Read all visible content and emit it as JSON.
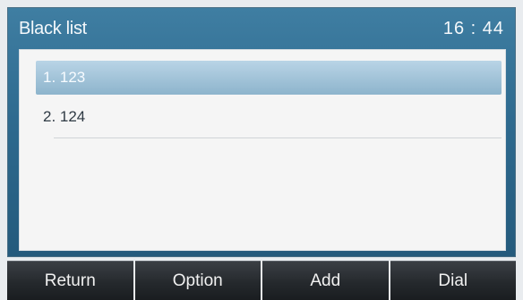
{
  "header": {
    "title": "Black list",
    "time": "16 : 44"
  },
  "list": {
    "items": [
      {
        "label": "1. 123",
        "selected": true
      },
      {
        "label": "2. 124",
        "selected": false
      }
    ]
  },
  "softkeys": {
    "return_label": "Return",
    "option_label": "Option",
    "add_label": "Add",
    "dial_label": "Dial"
  }
}
